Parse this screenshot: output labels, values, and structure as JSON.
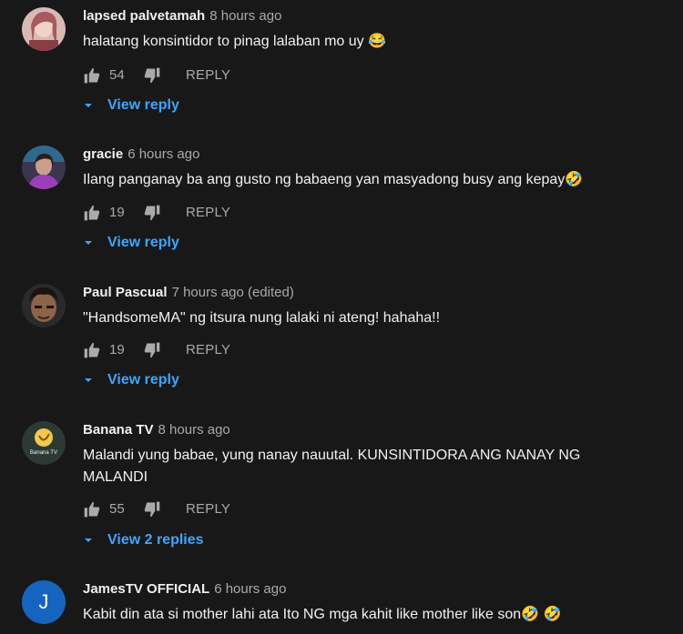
{
  "comments": [
    {
      "author": "lapsed palvetamah",
      "time": "8 hours ago",
      "text": "halatang konsintidor to pinag lalaban mo uy 😂",
      "likes": "54",
      "reply": "REPLY",
      "view_replies": "View reply",
      "avatar_color": "#c9a3a3"
    },
    {
      "author": "gracie",
      "time": "6 hours ago",
      "text": "Ilang panganay ba ang gusto ng babaeng yan masyadong busy ang kepay🤣",
      "likes": "19",
      "reply": "REPLY",
      "view_replies": "View reply",
      "avatar_color": "#6a4c8c"
    },
    {
      "author": "Paul Pascual",
      "time": "7 hours ago (edited)",
      "text": "\"HandsomeMA\" ng itsura nung lalaki ni ateng! hahaha!!",
      "likes": "19",
      "reply": "REPLY",
      "view_replies": "View reply",
      "avatar_color": "#5a4a3a"
    },
    {
      "author": "Banana TV",
      "time": "8 hours ago",
      "text": "Malandi yung babae, yung nanay nauutal. KUNSINTIDORA ANG NANAY NG MALANDI",
      "likes": "55",
      "reply": "REPLY",
      "view_replies": "View 2 replies",
      "avatar_color": "#2b3a35",
      "avatar_text": "Banana TV"
    },
    {
      "author": "JamesTV OFFICIAL",
      "time": "6 hours ago",
      "text": "Kabit din ata si mother lahi ata Ito NG mga kahit like mother like son🤣 🤣",
      "avatar_letter": "J",
      "avatar_color": "#1565c0"
    }
  ],
  "colors": {
    "background": "#181818",
    "link": "#3ea6ff",
    "secondary_text": "#aaaaaa"
  }
}
